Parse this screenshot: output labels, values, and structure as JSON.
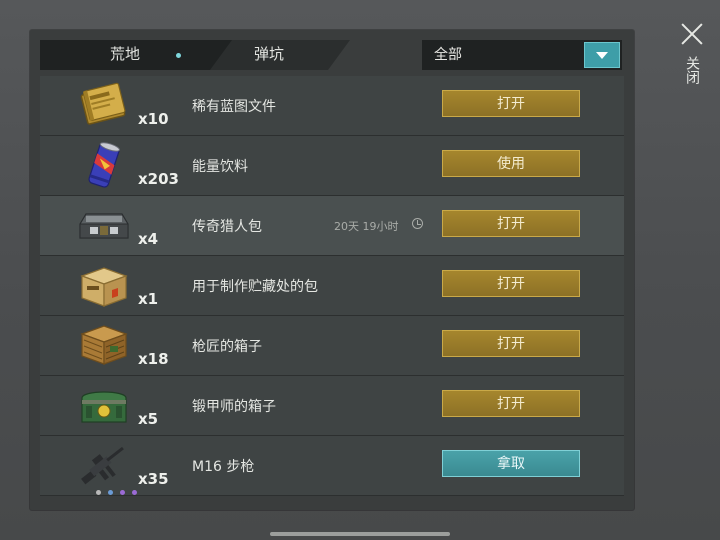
{
  "tabs": [
    {
      "label": "荒地"
    },
    {
      "label": "弹坑"
    }
  ],
  "filter": {
    "selected": "全部"
  },
  "close": {
    "label": "关闭"
  },
  "items": [
    {
      "name": "稀有蓝图文件",
      "qty": "x10",
      "action": "打开",
      "icon": "blueprint-folder-icon"
    },
    {
      "name": "能量饮料",
      "qty": "x203",
      "action": "使用",
      "icon": "energy-drink-can-icon"
    },
    {
      "name": "传奇猎人包",
      "qty": "x4",
      "action": "打开",
      "timer": "20天 19小时",
      "icon": "hunter-pack-icon"
    },
    {
      "name": "用于制作贮藏处的包",
      "qty": "x1",
      "action": "打开",
      "icon": "stash-crate-icon"
    },
    {
      "name": "枪匠的箱子",
      "qty": "x18",
      "action": "打开",
      "icon": "wooden-crate-icon"
    },
    {
      "name": "锻甲师的箱子",
      "qty": "x5",
      "action": "打开",
      "icon": "armor-chest-icon"
    },
    {
      "name": "M16 步枪",
      "qty": "x35",
      "action": "拿取",
      "icon": "rifle-icon"
    }
  ],
  "colors": {
    "action_gold": "#a6862d",
    "action_teal": "#4aa2a9",
    "accent_teal": "#3e9ea8"
  }
}
